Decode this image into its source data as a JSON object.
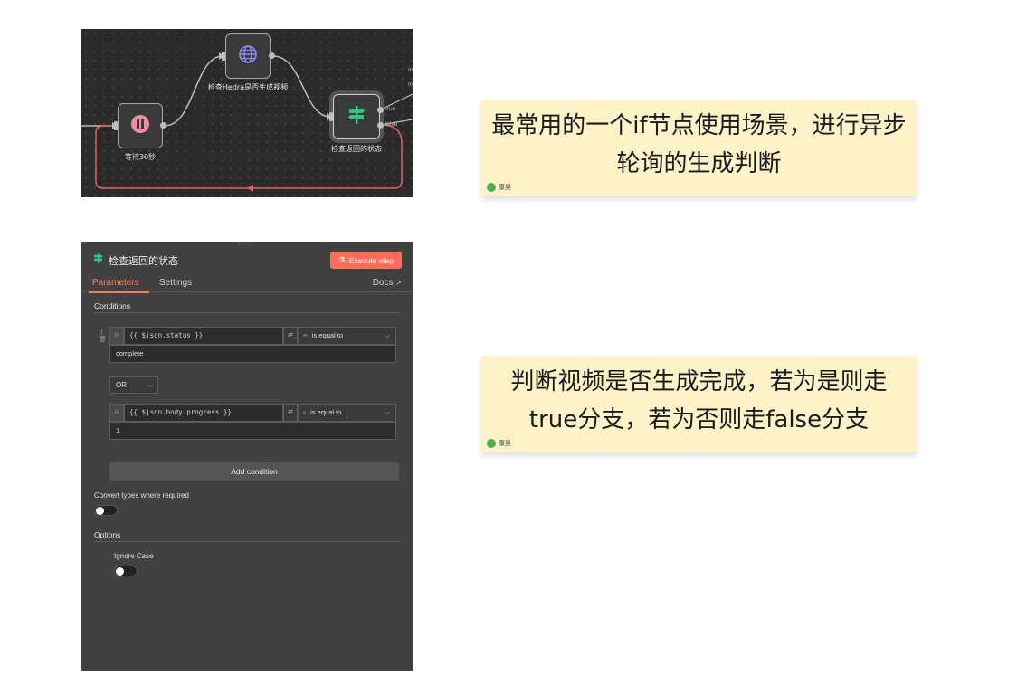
{
  "canvas": {
    "nodes": [
      {
        "label": "等待30秒",
        "icon": "pause-icon"
      },
      {
        "label": "检查Hedra是否生成视频",
        "icon": "globe-icon"
      },
      {
        "label": "检查返回的状态",
        "icon": "signpost-icon"
      }
    ],
    "ports": {
      "true_label": "true",
      "false_label": "false"
    },
    "cut_labels": [
      "In",
      "In"
    ],
    "colors": {
      "background": "#2b2b2b",
      "edge": "#bdbdbd",
      "loop_edge": "#e0645a"
    }
  },
  "notes": [
    {
      "text": "最常用的一个if节点使用场景，进行异步轮询的生成判断",
      "author": "康昊"
    },
    {
      "text": "判断视频是否生成完成，若为是则走true分支，若为否则走false分支",
      "author": "康昊"
    }
  ],
  "panel": {
    "title": "检查返回的状态",
    "execute_label": "Execute step",
    "tabs": [
      "Parameters",
      "Settings"
    ],
    "docs_label": "Docs",
    "conditions_title": "Conditions",
    "conditions": [
      {
        "fx": "fx",
        "expression": "{{ $json.status }}",
        "type_icon": "ᴬᴮ",
        "operator": "is equal to",
        "value": "complete"
      },
      {
        "fx": "fx",
        "expression": "{{ $json.body.progress }}",
        "type_icon": "#",
        "operator": "is equal to",
        "value": "1"
      }
    ],
    "combinator": "OR",
    "add_condition_label": "Add condition",
    "convert_types_label": "Convert types where required",
    "options_title": "Options",
    "ignore_case_label": "Ignore Case",
    "accent": "#ff6d5a"
  }
}
